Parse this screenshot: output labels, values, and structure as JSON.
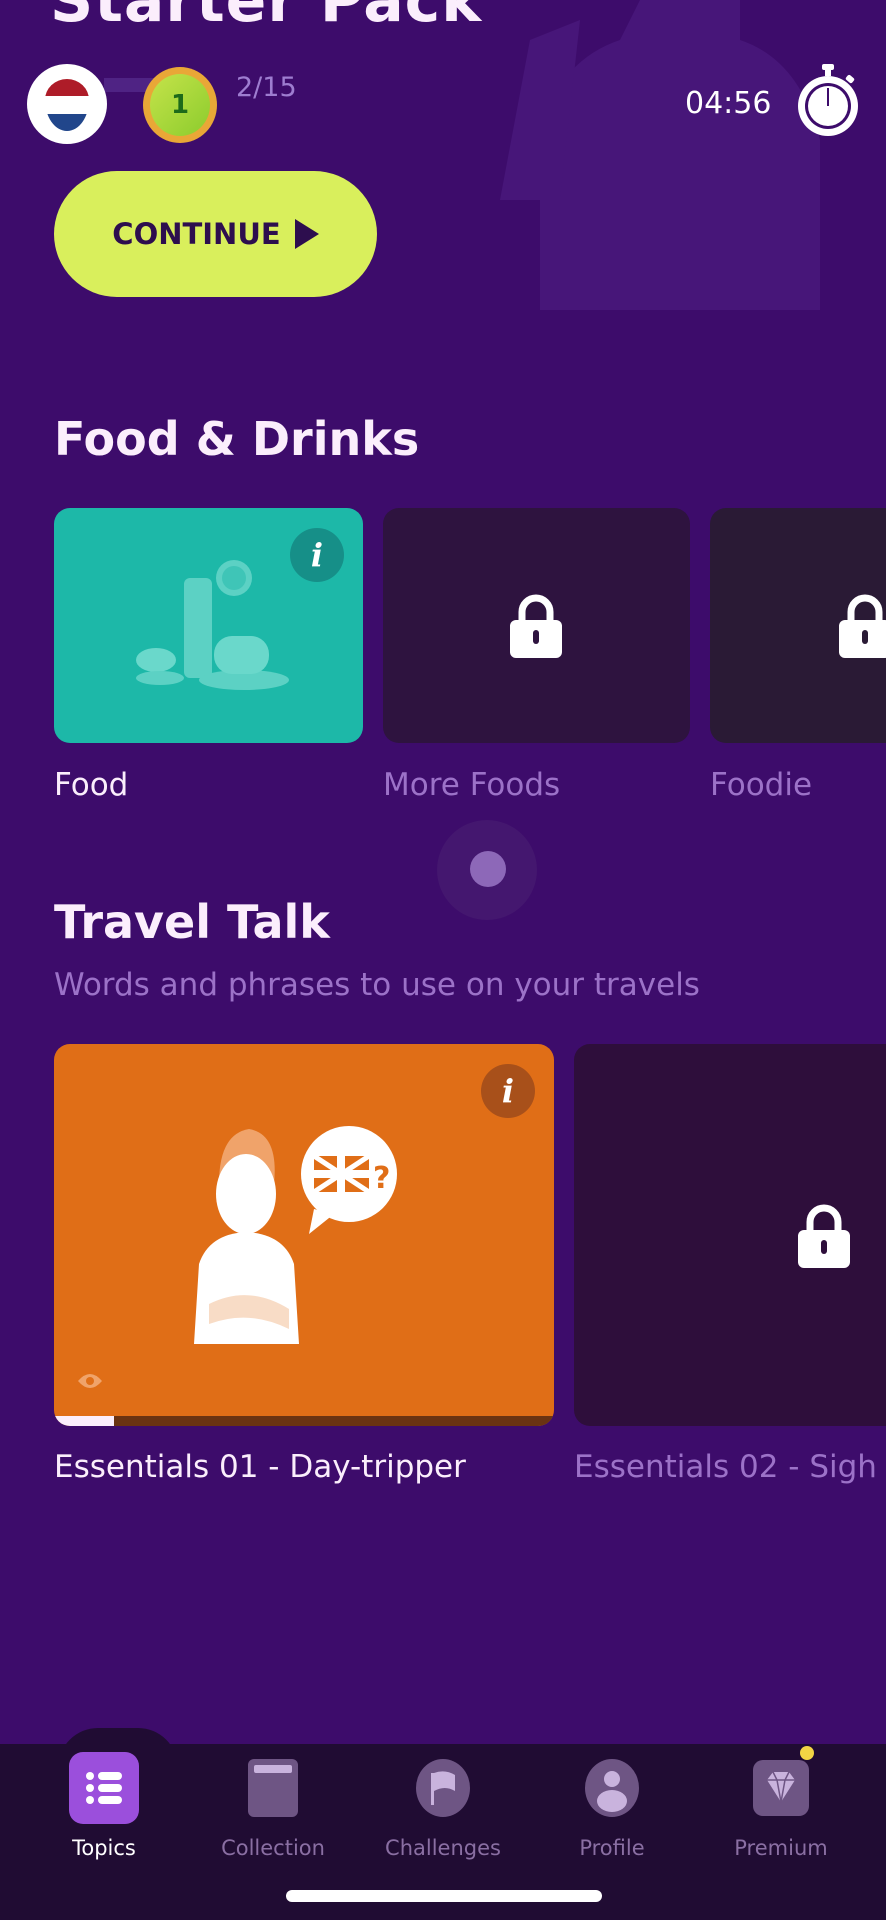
{
  "header": {
    "pack_title": "Starter Pack",
    "language_flag": "netherlands-flag",
    "level_badge": "1",
    "progress_count": "2/15",
    "timer": "04:56",
    "continue_label": "CONTINUE"
  },
  "sections": [
    {
      "title": "Food & Drinks",
      "subtitle": "",
      "cards": [
        {
          "label": "Food",
          "state": "unlocked",
          "color": "#1db8a8"
        },
        {
          "label": "More Foods",
          "state": "locked",
          "color": "#2e133f"
        },
        {
          "label": "Foodie",
          "state": "locked",
          "color": "#2a1a35"
        }
      ]
    },
    {
      "title": "Travel Talk",
      "subtitle": "Words and phrases to use on your travels",
      "cards": [
        {
          "label": "Essentials 01 - Day-tripper",
          "state": "unlocked",
          "color": "#e06e17",
          "progress": 0.12
        },
        {
          "label": "Essentials 02 - Sigh",
          "state": "locked",
          "color": "#2e0e3b"
        }
      ]
    }
  ],
  "nav": {
    "items": [
      {
        "label": "Topics",
        "icon": "list-icon",
        "active": true
      },
      {
        "label": "Collection",
        "icon": "book-icon",
        "active": false
      },
      {
        "label": "Challenges",
        "icon": "flag-icon",
        "active": false
      },
      {
        "label": "Profile",
        "icon": "person-icon",
        "active": false
      },
      {
        "label": "Premium",
        "icon": "diamond-icon",
        "active": false,
        "badge": true
      }
    ]
  },
  "colors": {
    "background": "#3d0c6b",
    "accent_button": "#d9ef5c",
    "nav_active": "#9b4fdc",
    "badge_dot": "#f2d544"
  }
}
